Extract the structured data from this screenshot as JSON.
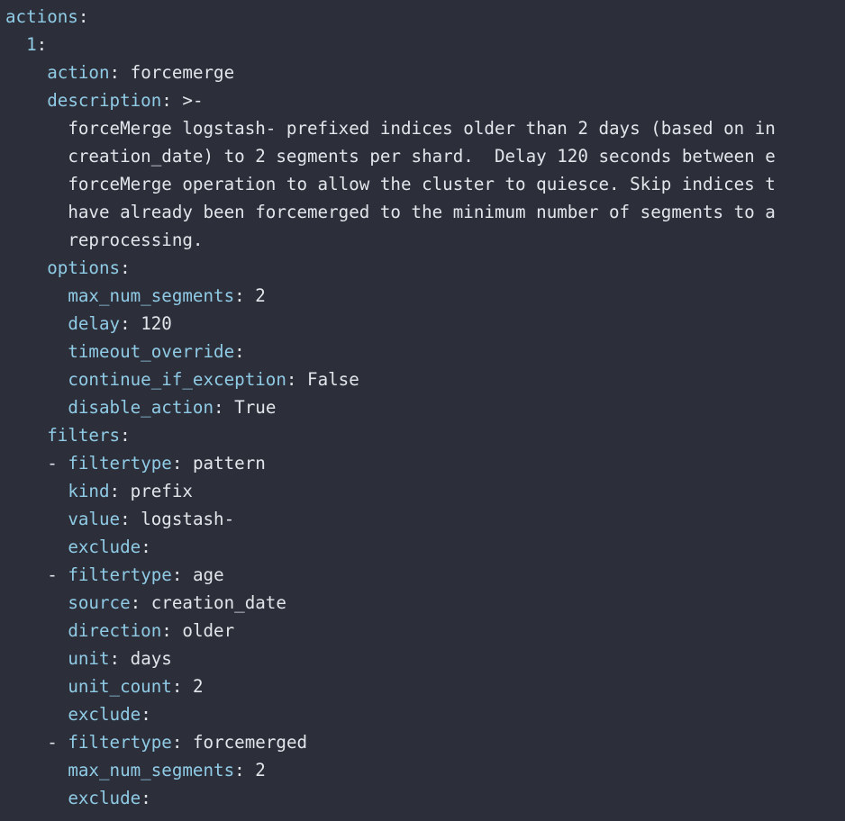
{
  "theme": {
    "background": "#2c2f3a",
    "key_color": "#90cbe6",
    "value_color": "#e2e5ea"
  },
  "lines": [
    {
      "indent": "",
      "dash": "",
      "key": "actions",
      "colon": ":",
      "value": ""
    },
    {
      "indent": "  ",
      "dash": "",
      "key": "1",
      "colon": ":",
      "value": ""
    },
    {
      "indent": "    ",
      "dash": "",
      "key": "action",
      "colon": ":",
      "value": " forcemerge"
    },
    {
      "indent": "    ",
      "dash": "",
      "key": "description",
      "colon": ":",
      "value": " >-"
    },
    {
      "indent": "      ",
      "dash": "",
      "key": "",
      "colon": "",
      "value": "forceMerge logstash- prefixed indices older than 2 days (based on in"
    },
    {
      "indent": "      ",
      "dash": "",
      "key": "",
      "colon": "",
      "value": "creation_date) to 2 segments per shard.  Delay 120 seconds between e"
    },
    {
      "indent": "      ",
      "dash": "",
      "key": "",
      "colon": "",
      "value": "forceMerge operation to allow the cluster to quiesce. Skip indices t"
    },
    {
      "indent": "      ",
      "dash": "",
      "key": "",
      "colon": "",
      "value": "have already been forcemerged to the minimum number of segments to a"
    },
    {
      "indent": "      ",
      "dash": "",
      "key": "",
      "colon": "",
      "value": "reprocessing."
    },
    {
      "indent": "    ",
      "dash": "",
      "key": "options",
      "colon": ":",
      "value": ""
    },
    {
      "indent": "      ",
      "dash": "",
      "key": "max_num_segments",
      "colon": ":",
      "value": " 2"
    },
    {
      "indent": "      ",
      "dash": "",
      "key": "delay",
      "colon": ":",
      "value": " 120"
    },
    {
      "indent": "      ",
      "dash": "",
      "key": "timeout_override",
      "colon": ":",
      "value": ""
    },
    {
      "indent": "      ",
      "dash": "",
      "key": "continue_if_exception",
      "colon": ":",
      "value": " False"
    },
    {
      "indent": "      ",
      "dash": "",
      "key": "disable_action",
      "colon": ":",
      "value": " True"
    },
    {
      "indent": "    ",
      "dash": "",
      "key": "filters",
      "colon": ":",
      "value": ""
    },
    {
      "indent": "    ",
      "dash": "- ",
      "key": "filtertype",
      "colon": ":",
      "value": " pattern"
    },
    {
      "indent": "      ",
      "dash": "",
      "key": "kind",
      "colon": ":",
      "value": " prefix"
    },
    {
      "indent": "      ",
      "dash": "",
      "key": "value",
      "colon": ":",
      "value": " logstash-"
    },
    {
      "indent": "      ",
      "dash": "",
      "key": "exclude",
      "colon": ":",
      "value": ""
    },
    {
      "indent": "    ",
      "dash": "- ",
      "key": "filtertype",
      "colon": ":",
      "value": " age"
    },
    {
      "indent": "      ",
      "dash": "",
      "key": "source",
      "colon": ":",
      "value": " creation_date"
    },
    {
      "indent": "      ",
      "dash": "",
      "key": "direction",
      "colon": ":",
      "value": " older"
    },
    {
      "indent": "      ",
      "dash": "",
      "key": "unit",
      "colon": ":",
      "value": " days"
    },
    {
      "indent": "      ",
      "dash": "",
      "key": "unit_count",
      "colon": ":",
      "value": " 2"
    },
    {
      "indent": "      ",
      "dash": "",
      "key": "exclude",
      "colon": ":",
      "value": ""
    },
    {
      "indent": "    ",
      "dash": "- ",
      "key": "filtertype",
      "colon": ":",
      "value": " forcemerged"
    },
    {
      "indent": "      ",
      "dash": "",
      "key": "max_num_segments",
      "colon": ":",
      "value": " 2"
    },
    {
      "indent": "      ",
      "dash": "",
      "key": "exclude",
      "colon": ":",
      "value": ""
    }
  ]
}
